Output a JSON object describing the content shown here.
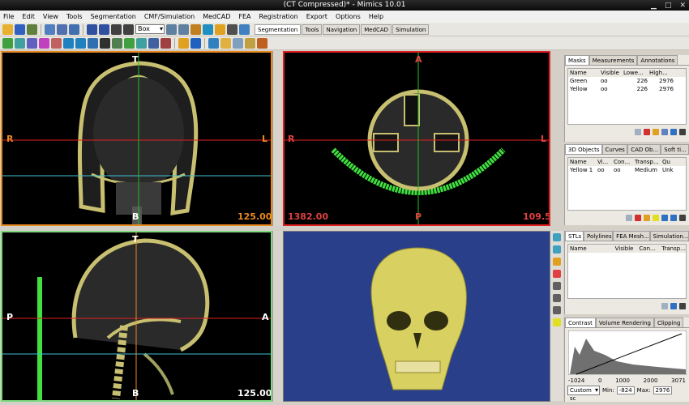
{
  "title": "(CT Compressed)* - Mimics 10.01",
  "menu": [
    "File",
    "Edit",
    "View",
    "Tools",
    "Segmentation",
    "CMF/Simulation",
    "MedCAD",
    "FEA",
    "Registration",
    "Export",
    "Options",
    "Help"
  ],
  "toolbar": {
    "combo": "Box",
    "tabs": [
      "Segmentation",
      "Tools",
      "Navigation",
      "MedCAD",
      "Simulation"
    ]
  },
  "views": {
    "coronal": {
      "top": "T",
      "bottom": "B",
      "left": "R",
      "right": "L",
      "value": "125.00",
      "border": "#e88a20"
    },
    "axial": {
      "top": "A",
      "bottom": "P",
      "left": "R",
      "right": "L",
      "value": "109.5",
      "value_left": "1382.00",
      "border": "#e02020"
    },
    "sagittal": {
      "top": "T",
      "bottom": "B",
      "left": "P",
      "right": "A",
      "value": "125.00",
      "border": "#7cd97c"
    }
  },
  "masks": {
    "tabs": [
      "Masks",
      "Measurements",
      "Annotations"
    ],
    "headers": [
      "Name",
      "Visible",
      "Lowe...",
      "High..."
    ],
    "rows": [
      {
        "name": "Green",
        "visible": "oo",
        "low": "226",
        "high": "2976",
        "color": "#20c020"
      },
      {
        "name": "Yellow",
        "visible": "oo",
        "low": "226",
        "high": "2976",
        "color": "#e0e020"
      }
    ]
  },
  "objects3d": {
    "tabs": [
      "3D Objects",
      "Curves",
      "CAD Ob...",
      "Soft ti..."
    ],
    "headers": [
      "Name",
      "Vi...",
      "Con...",
      "Transp...",
      "Qu"
    ],
    "rows": [
      {
        "name": "Yellow 1",
        "visible": "oo",
        "contour": "oo",
        "transparency": "Medium",
        "quality": "Unk"
      }
    ]
  },
  "stls": {
    "tabs": [
      "STLs",
      "Polylines",
      "FEA Mesh...",
      "Simulation..."
    ],
    "headers": [
      "Name",
      "Visible",
      "Con...",
      "Transp..."
    ]
  },
  "contrast": {
    "tabs": [
      "Contrast",
      "Volume Rendering",
      "Clipping"
    ],
    "axis": [
      "-1024",
      "0",
      "1000",
      "2000",
      "3071"
    ],
    "preset": "Custom sc",
    "min_label": "Min:",
    "min": "-824",
    "max_label": "Max:",
    "max": "2976"
  },
  "colors": {
    "skull": "#d8d060",
    "bone_ct": "#c8c070",
    "cursor_red": "#e02020",
    "cursor_green": "#20c020",
    "cursor_cyan": "#40c0d0",
    "blue_bg": "#2a3f8a"
  }
}
